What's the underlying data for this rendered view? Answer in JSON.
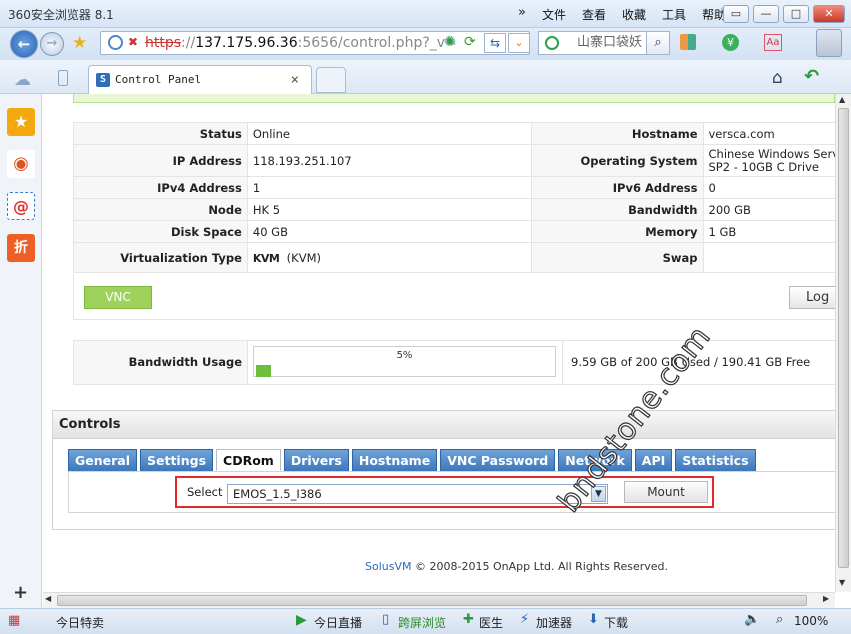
{
  "browser": {
    "app_title": "360安全浏览器 8.1",
    "menu": [
      "文件",
      "查看",
      "收藏",
      "工具",
      "帮助"
    ],
    "url_scheme": "https",
    "url_host": "137.175.96.36",
    "url_path": ":5656/control.php?_v=",
    "search_text": "山寨口袋妖",
    "tab_title": "Control Panel"
  },
  "server_info": {
    "rows": [
      {
        "l1": "Status",
        "v1": "Online",
        "l2": "Hostname",
        "v2": "versca.com"
      },
      {
        "l1": "IP Address",
        "v1": "118.193.251.107",
        "l2": "Operating System",
        "v2": "Chinese Windows Serv",
        "v2b": "SP2 - 10GB C Drive"
      },
      {
        "l1": "IPv4 Address",
        "v1": "1",
        "l2": "IPv6 Address",
        "v2": "0"
      },
      {
        "l1": "Node",
        "v1": "HK 5",
        "l2": "Bandwidth",
        "v2": "200 GB"
      },
      {
        "l1": "Disk Space",
        "v1": "40 GB",
        "l2": "Memory",
        "v2": "1 GB"
      },
      {
        "l1": "Virtualization Type",
        "v1": "KVM",
        "v1_extra": "(KVM)",
        "l2": "Swap",
        "v2": ""
      }
    ]
  },
  "buttons": {
    "vnc": "VNC",
    "logout": "Log"
  },
  "bandwidth": {
    "label": "Bandwidth Usage",
    "percent_text": "5%",
    "percent": 5,
    "detail": "9.59 GB of 200 GB Used / 190.41 GB Free"
  },
  "controls": {
    "title": "Controls",
    "tabs": [
      "General",
      "Settings",
      "CDRom",
      "Drivers",
      "Hostname",
      "VNC Password",
      "Network",
      "API",
      "Statistics"
    ],
    "active_tab": "CDRom",
    "select_label": "Select",
    "select_value": "EMOS_1.5_I386",
    "mount_label": "Mount"
  },
  "footer": {
    "brand": "SolusVM",
    "text": "© 2008-2015 OnApp Ltd. All Rights Reserved."
  },
  "watermark": "bndstone.com",
  "statusbar": {
    "left": "今日特卖",
    "items": [
      "今日直播",
      "跨屏浏览",
      "医生",
      "加速器",
      "下载"
    ],
    "zoom": "100%"
  }
}
